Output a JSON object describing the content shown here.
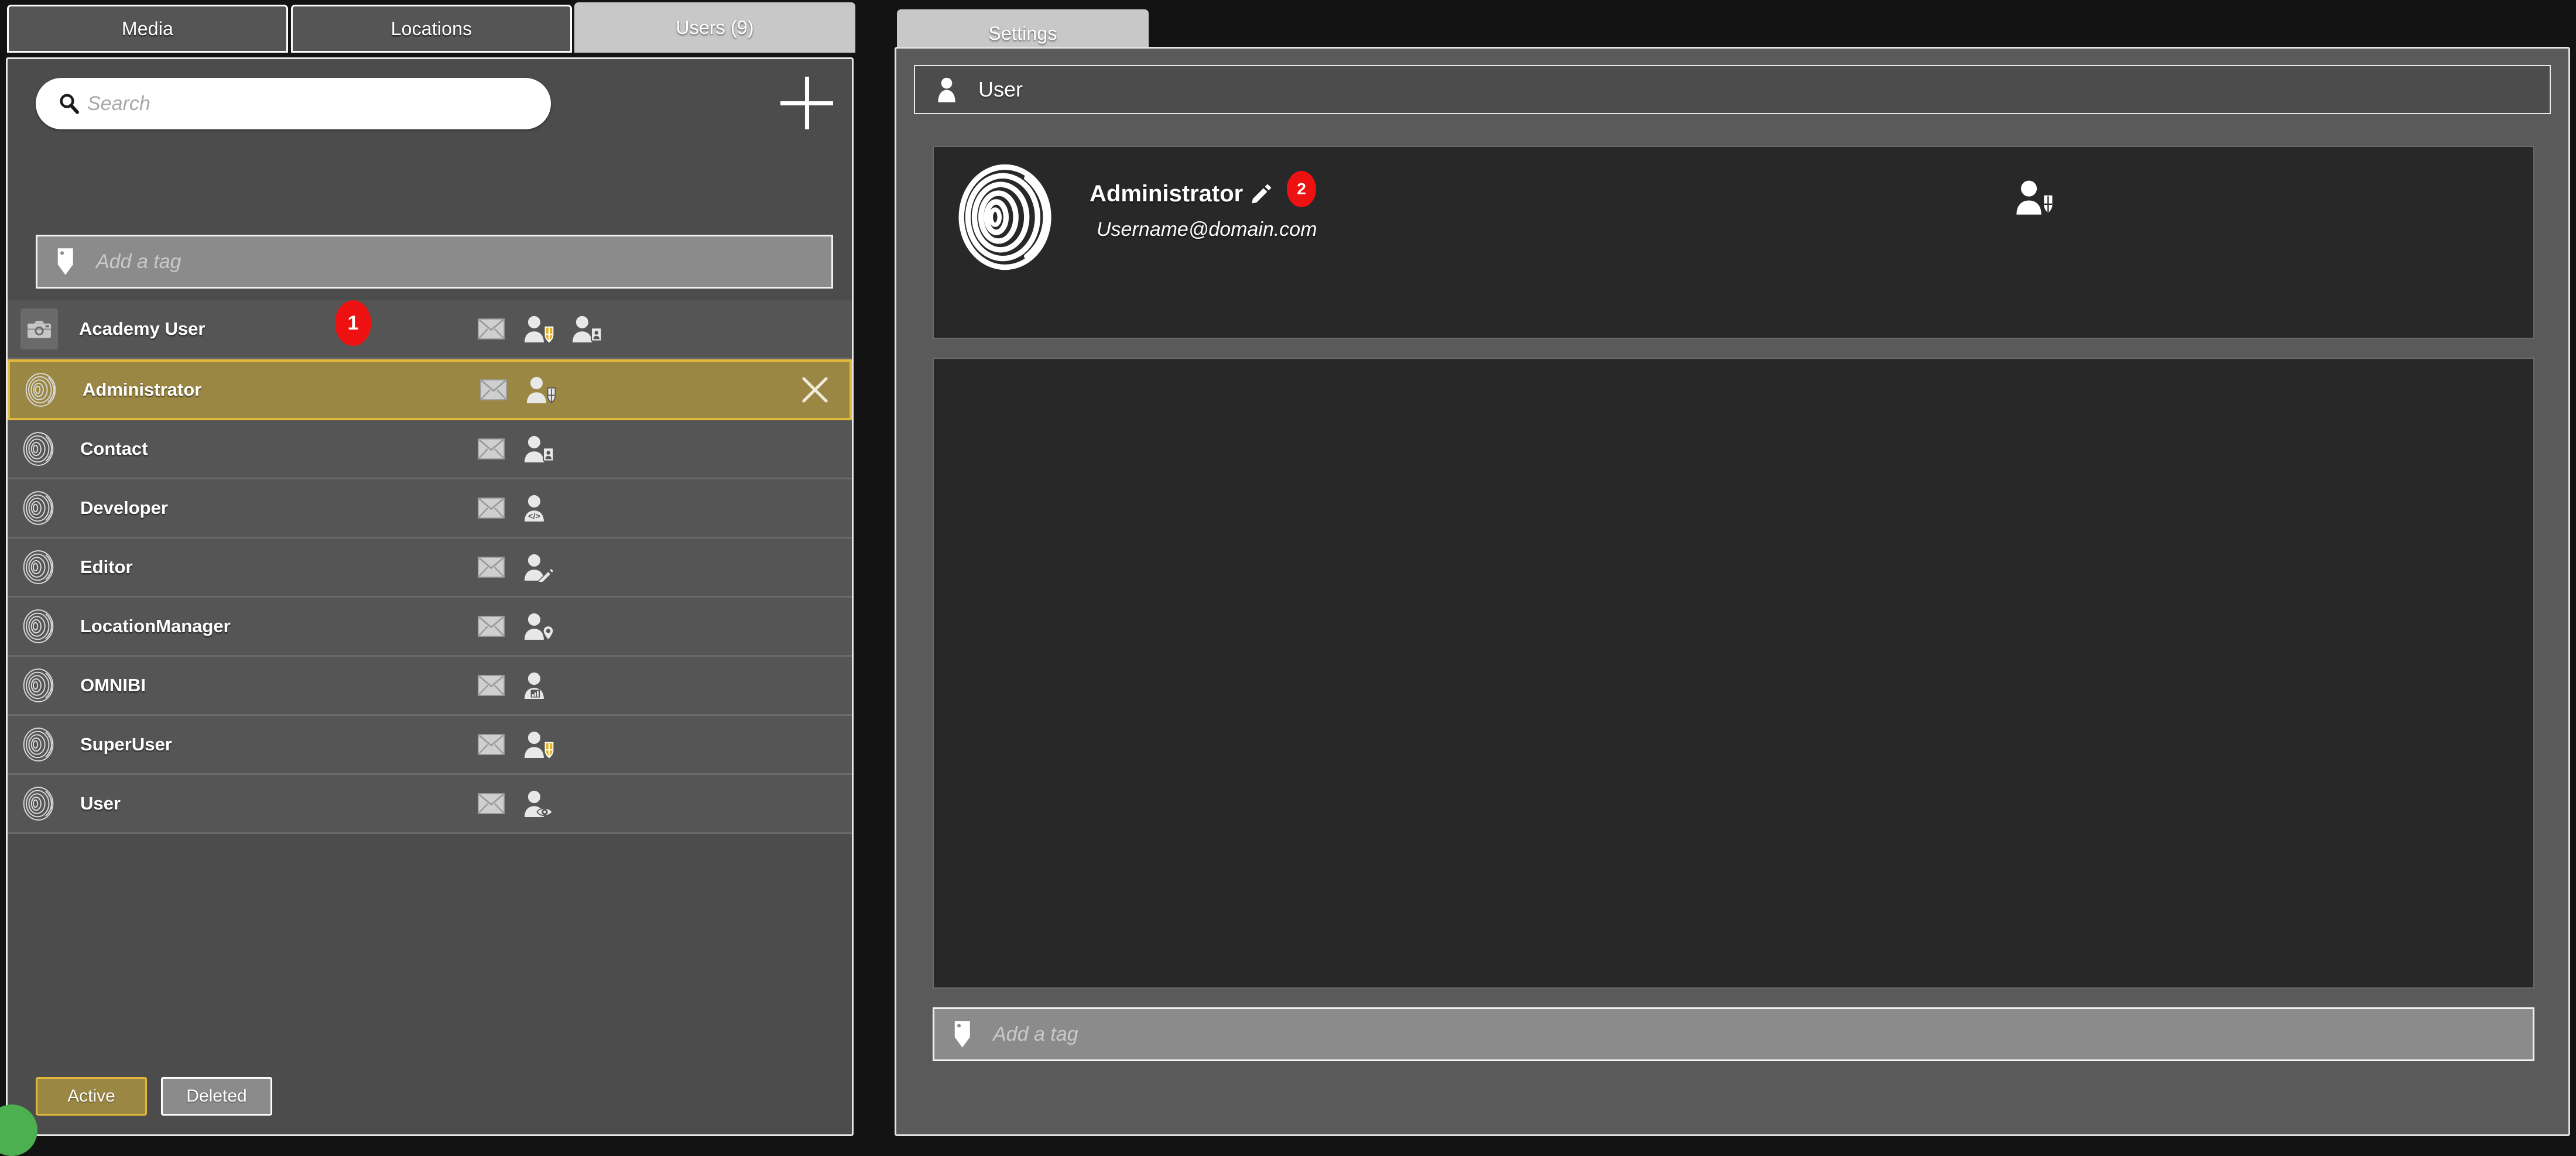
{
  "tabs": [
    {
      "label": "Media",
      "active": false
    },
    {
      "label": "Locations",
      "active": false
    },
    {
      "label": "Users (9)",
      "active": true
    },
    {
      "label": "Settings",
      "active": true
    }
  ],
  "left_panel": {
    "search": {
      "placeholder": "Search",
      "value": "",
      "icon": "search-icon"
    },
    "add_button": {
      "icon": "plus-icon",
      "label": "+"
    },
    "tag_input": {
      "placeholder": "Add a tag",
      "value": "",
      "icon": "tag-icon"
    },
    "users": [
      {
        "name": "Academy User",
        "avatar": "camera-placeholder",
        "email_icon": "envelope-icon",
        "role_icons": [
          "user-shield-gold-icon",
          "user-idcard-icon"
        ],
        "selected": false
      },
      {
        "name": "Administrator",
        "avatar": "fingerprint",
        "email_icon": "envelope-icon",
        "role_icons": [
          "user-shield-icon"
        ],
        "selected": true
      },
      {
        "name": "Contact",
        "avatar": "fingerprint",
        "email_icon": "envelope-icon",
        "role_icons": [
          "user-idcard-icon"
        ],
        "selected": false
      },
      {
        "name": "Developer",
        "avatar": "fingerprint",
        "email_icon": "envelope-icon",
        "role_icons": [
          "user-code-icon"
        ],
        "selected": false
      },
      {
        "name": "Editor",
        "avatar": "fingerprint",
        "email_icon": "envelope-icon",
        "role_icons": [
          "user-pencil-icon"
        ],
        "selected": false
      },
      {
        "name": "LocationManager",
        "avatar": "fingerprint",
        "email_icon": "envelope-icon",
        "role_icons": [
          "user-pin-icon"
        ],
        "selected": false
      },
      {
        "name": "OMNIBI",
        "avatar": "fingerprint",
        "email_icon": "envelope-icon",
        "role_icons": [
          "user-chart-icon"
        ],
        "selected": false
      },
      {
        "name": "SuperUser",
        "avatar": "fingerprint",
        "email_icon": "envelope-icon",
        "role_icons": [
          "user-shield-gold-icon"
        ],
        "selected": false
      },
      {
        "name": "User",
        "avatar": "fingerprint",
        "email_icon": "envelope-icon",
        "role_icons": [
          "user-eye-icon"
        ],
        "selected": false
      }
    ],
    "close_icon": "close-icon",
    "filters": [
      {
        "label": "Active",
        "active": true
      },
      {
        "label": "Deleted",
        "active": false
      }
    ]
  },
  "right_panel": {
    "header": {
      "title": "User",
      "icon": "user-icon"
    },
    "detail": {
      "avatar_icon": "fingerprint-icon",
      "name": "Administrator",
      "edit_icon": "pencil-icon",
      "email": "Username@domain.com",
      "role_icon": "user-shield-icon"
    },
    "tag_input": {
      "placeholder": "Add a tag",
      "value": "",
      "icon": "tag-icon"
    }
  },
  "annotations": [
    {
      "id": "1",
      "label": "1"
    },
    {
      "id": "2",
      "label": "2"
    }
  ],
  "colors": {
    "accent_gold": "#9b8744",
    "accent_gold_border": "#e3b93c",
    "panel_bg": "#4c4c4c",
    "panel_bg_alt": "#5a5a5a",
    "content_bg": "#282828",
    "annotation_red": "#ee1111",
    "status_green": "#4cb050"
  }
}
